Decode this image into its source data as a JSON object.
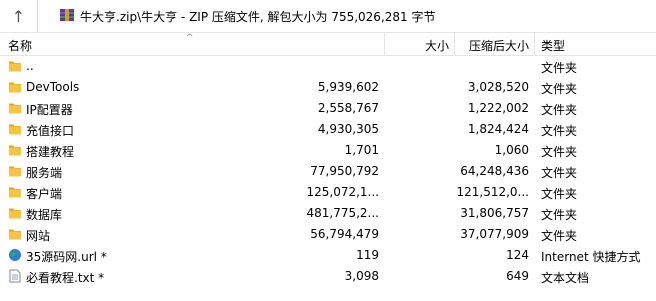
{
  "address": {
    "path": "牛大亨.zip\\牛大亨 - ZIP 压缩文件, 解包大小为 755,026,281 字节"
  },
  "columns": {
    "name": "名称",
    "size": "大小",
    "packed": "压缩后大小",
    "type": "类型"
  },
  "rows": [
    {
      "name": "..",
      "size": "",
      "packed": "",
      "type": "文件夹",
      "icon": "folder-icon"
    },
    {
      "name": "DevTools",
      "size": "5,939,602",
      "packed": "3,028,520",
      "type": "文件夹",
      "icon": "folder-icon"
    },
    {
      "name": "IP配置器",
      "size": "2,558,767",
      "packed": "1,222,002",
      "type": "文件夹",
      "icon": "folder-icon"
    },
    {
      "name": "充值接口",
      "size": "4,930,305",
      "packed": "1,824,424",
      "type": "文件夹",
      "icon": "folder-icon"
    },
    {
      "name": "搭建教程",
      "size": "1,701",
      "packed": "1,060",
      "type": "文件夹",
      "icon": "folder-icon"
    },
    {
      "name": "服务端",
      "size": "77,950,792",
      "packed": "64,248,436",
      "type": "文件夹",
      "icon": "folder-icon"
    },
    {
      "name": "客户端",
      "size": "125,072,1...",
      "packed": "121,512,0...",
      "type": "文件夹",
      "icon": "folder-icon"
    },
    {
      "name": "数据库",
      "size": "481,775,2...",
      "packed": "31,806,757",
      "type": "文件夹",
      "icon": "folder-icon"
    },
    {
      "name": "网站",
      "size": "56,794,479",
      "packed": "37,077,909",
      "type": "文件夹",
      "icon": "folder-icon"
    },
    {
      "name": "35源码网.url *",
      "size": "119",
      "packed": "124",
      "type": "Internet 快捷方式",
      "icon": "globe-icon"
    },
    {
      "name": "必看教程.txt *",
      "size": "3,098",
      "packed": "649",
      "type": "文本文档",
      "icon": "text-file-icon"
    }
  ],
  "colors": {
    "folder": "#f5c542",
    "folder_dark": "#dba920",
    "globe": "#2a7fd4"
  }
}
